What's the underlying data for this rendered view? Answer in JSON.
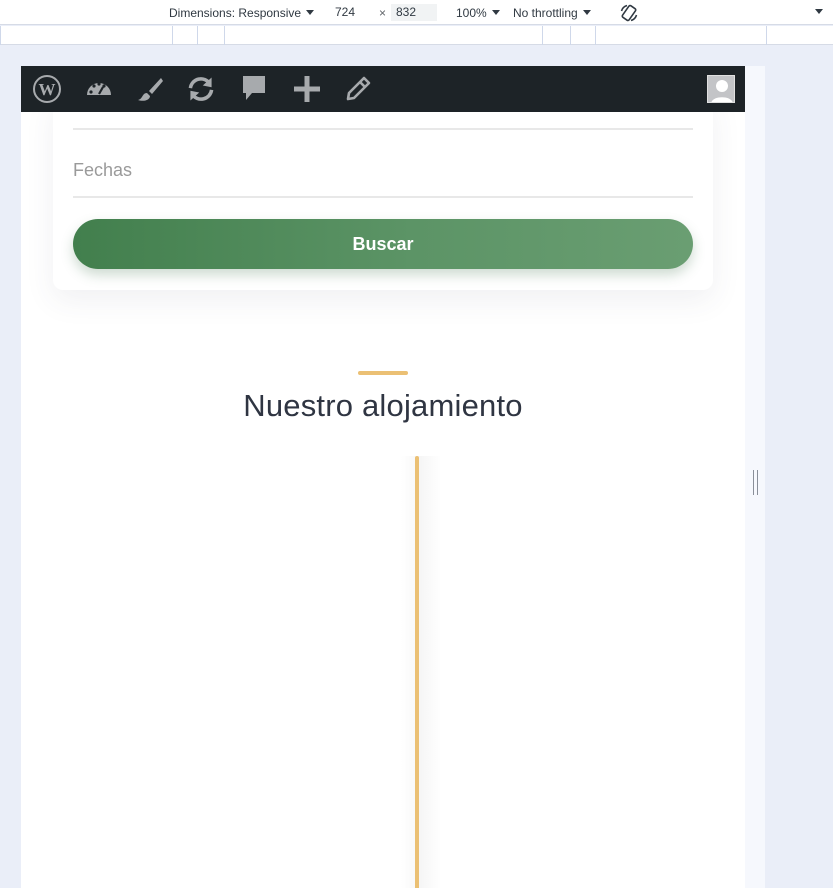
{
  "devtools": {
    "dimensions_label": "Dimensions: Responsive",
    "width_value": "724",
    "times_symbol": "×",
    "height_value": "832",
    "zoom_label": "100%",
    "throttling_label": "No throttling",
    "rotate_icon": "rotate-icon",
    "more_icon": "chevron-down-icon"
  },
  "admin_bar": {
    "background": "#1d2327",
    "icons": [
      "wordpress-logo-icon",
      "dashboard-icon",
      "customize-brush-icon",
      "updates-icon",
      "comments-icon",
      "new-content-plus-icon",
      "edit-pencil-icon"
    ],
    "avatar": "user-avatar"
  },
  "search_card": {
    "dates_label": "Fechas",
    "search_button_label": "Buscar",
    "button_gradient": [
      "#427f4d",
      "#6a9e72"
    ]
  },
  "section": {
    "title": "Nuestro alojamiento",
    "accent_color": "#ebc074"
  }
}
